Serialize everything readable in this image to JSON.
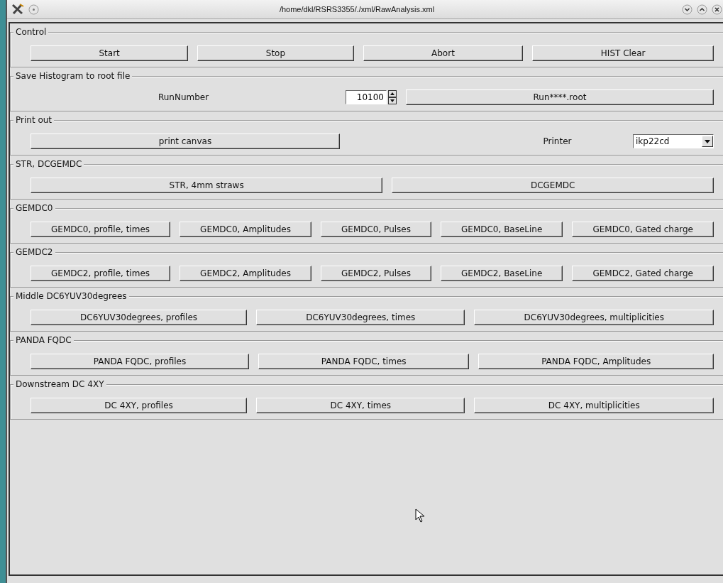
{
  "window": {
    "title": "/home/dkl/RSRS3355/./xml/RawAnalysis.xml"
  },
  "groups": [
    {
      "title": "Control",
      "items": [
        {
          "kind": "button",
          "label": "Start"
        },
        {
          "kind": "button",
          "label": "Stop"
        },
        {
          "kind": "button",
          "label": "Abort"
        },
        {
          "kind": "button",
          "label": "HIST Clear"
        }
      ]
    },
    {
      "title": "Save Histogram to root file",
      "items": [
        {
          "kind": "label",
          "label": "RunNumber"
        },
        {
          "kind": "spin",
          "value": "10100"
        },
        {
          "kind": "button",
          "label": "Run****.root"
        }
      ]
    },
    {
      "title": "Print out",
      "items": [
        {
          "kind": "button",
          "label": "print canvas"
        },
        {
          "kind": "label",
          "label": "Printer"
        },
        {
          "kind": "combo",
          "value": "ikp22cd"
        }
      ]
    },
    {
      "title": "STR, DCGEMDC",
      "items": [
        {
          "kind": "button",
          "label": "STR, 4mm straws"
        },
        {
          "kind": "button",
          "label": "DCGEMDC"
        }
      ]
    },
    {
      "title": "GEMDC0",
      "items": [
        {
          "kind": "button",
          "label": "GEMDC0, profile, times"
        },
        {
          "kind": "button",
          "label": "GEMDC0, Amplitudes"
        },
        {
          "kind": "button",
          "label": "GEMDC0, Pulses"
        },
        {
          "kind": "button",
          "label": "GEMDC0, BaseLine"
        },
        {
          "kind": "button",
          "label": "GEMDC0, Gated charge"
        }
      ]
    },
    {
      "title": "GEMDC2",
      "items": [
        {
          "kind": "button",
          "label": "GEMDC2, profile, times"
        },
        {
          "kind": "button",
          "label": "GEMDC2, Amplitudes"
        },
        {
          "kind": "button",
          "label": "GEMDC2, Pulses"
        },
        {
          "kind": "button",
          "label": "GEMDC2, BaseLine"
        },
        {
          "kind": "button",
          "label": "GEMDC2, Gated charge"
        }
      ]
    },
    {
      "title": "Middle DC6YUV30degrees",
      "items": [
        {
          "kind": "button",
          "label": "DC6YUV30degrees, profiles"
        },
        {
          "kind": "button",
          "label": "DC6YUV30degrees, times"
        },
        {
          "kind": "button",
          "label": "DC6YUV30degrees, multiplicities"
        }
      ]
    },
    {
      "title": "PANDA FQDC",
      "items": [
        {
          "kind": "button",
          "label": "PANDA FQDC, profiles"
        },
        {
          "kind": "button",
          "label": "PANDA FQDC, times"
        },
        {
          "kind": "button",
          "label": "PANDA FQDC, Amplitudes"
        }
      ]
    },
    {
      "title": "Downstream DC 4XY",
      "items": [
        {
          "kind": "button",
          "label": "DC 4XY, profiles"
        },
        {
          "kind": "button",
          "label": "DC 4XY, times"
        },
        {
          "kind": "button",
          "label": "DC 4XY, multiplicities"
        }
      ]
    }
  ]
}
